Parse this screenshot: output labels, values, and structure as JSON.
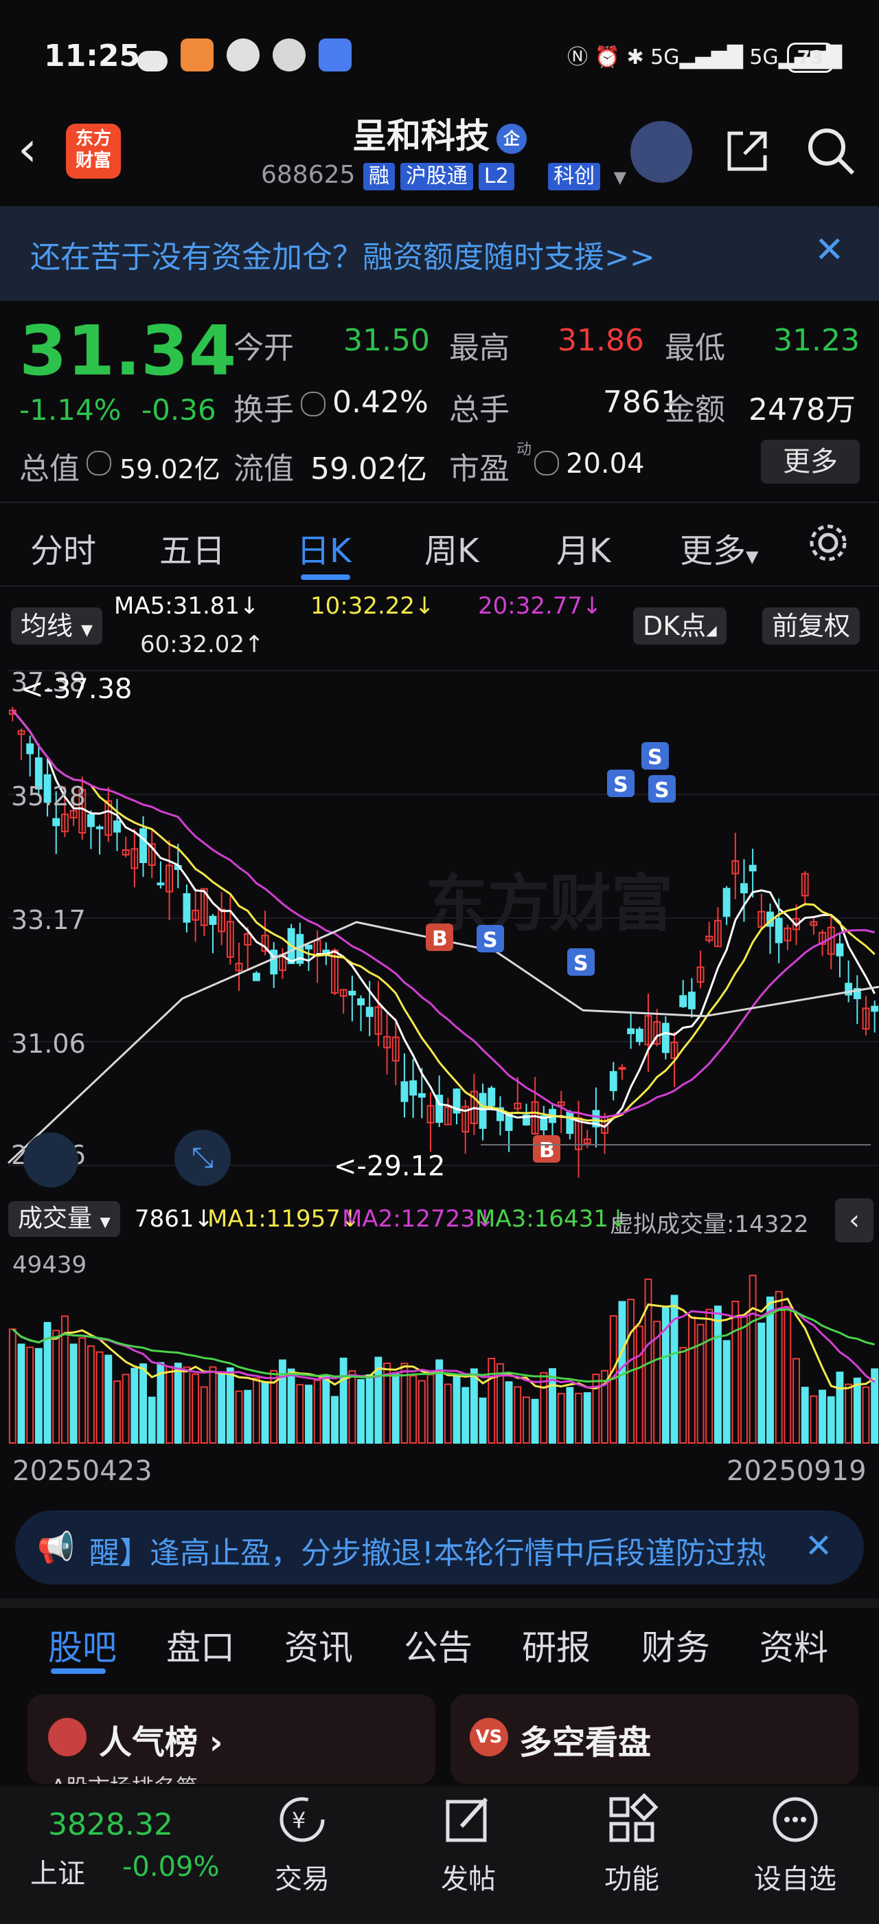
{
  "status": {
    "time": "11:25",
    "battery": "73",
    "network": "5G"
  },
  "header": {
    "logo": "东方\n财富",
    "title": "呈和科技",
    "badge": "企",
    "code": "688625",
    "tags": [
      "融",
      "沪股通",
      "L2",
      "科创"
    ]
  },
  "banner": {
    "text": "还在苦于没有资金加仓？融资额度随时支援>>",
    "close": "✕"
  },
  "quote": {
    "price": "31.34",
    "pct": "-1.14%",
    "change": "-0.36",
    "open_label": "今开",
    "open": "31.50",
    "high_label": "最高",
    "high": "31.86",
    "low_label": "最低",
    "low": "31.23",
    "turnover_label": "换手",
    "turnover": "0.42%",
    "volume_label": "总手",
    "volume": "7861",
    "amount_label": "金额",
    "amount": "2478万",
    "mktcap_label": "总值",
    "mktcap": "59.02亿",
    "float_label": "流值",
    "float": "59.02亿",
    "pe_label": "市盈",
    "pe_sup": "动",
    "pe": "20.04",
    "more": "更多"
  },
  "period_tabs": [
    "分时",
    "五日",
    "日K",
    "周K",
    "月K",
    "更多"
  ],
  "chart_toolbar": {
    "indicator": "均线",
    "ma5": "MA5:31.81↓",
    "ma10": "10:32.22↓",
    "ma20": "20:32.77↓",
    "ma60": "60:32.02↑",
    "dk": "DK点",
    "adjust": "前复权"
  },
  "price_axis": [
    "37.38",
    "35.28",
    "33.17",
    "31.06",
    "28.96"
  ],
  "annotations": {
    "high": "<-37.38",
    "low": "<-29.12",
    "buy": "B",
    "sell": "S"
  },
  "volume_bar": {
    "label": "成交量",
    "vol": "7861↓",
    "ma1": "MA1:11957↓",
    "ma2": "MA2:12723↓",
    "ma3": "MA3:16431↓",
    "virtual": "虚拟成交量:14322",
    "vmax": "49439"
  },
  "dates": {
    "start": "20250423",
    "end": "20250919"
  },
  "colors": {
    "up": "#f03a3a",
    "down": "#5be7ef",
    "ma5": "#ffffff",
    "ma10": "#f5e84a",
    "ma20": "#d23fd2",
    "ma60": "#d8d8d8",
    "accent": "#3d8bf5"
  },
  "chart_data": {
    "type": "candlestick",
    "y_range": [
      28.96,
      37.38
    ],
    "x_range": [
      "20250423",
      "20250919"
    ],
    "max_high": 37.38,
    "min_low": 29.12,
    "last_close": 31.34,
    "series": [
      {
        "name": "MA5",
        "last": 31.81
      },
      {
        "name": "MA10",
        "last": 32.22
      },
      {
        "name": "MA20",
        "last": 32.77
      },
      {
        "name": "MA60",
        "last": 32.02
      }
    ],
    "volume": {
      "max": 49439,
      "last": 7861,
      "MA1": 11957,
      "MA2": 12723,
      "MA3": 16431
    }
  },
  "alert": {
    "text": "醒】逢高止盈，分步撤退!本轮行情中后段谨防过热",
    "close": "✕"
  },
  "bottom_tabs": [
    "股吧",
    "盘口",
    "资讯",
    "公告",
    "研报",
    "财务",
    "资料"
  ],
  "cards": [
    {
      "title": "人气榜",
      "sub": "A股市场排名第"
    },
    {
      "title": "多空看盘"
    }
  ],
  "index": {
    "value": "3828.32",
    "name": "上证",
    "pct": "-0.09%"
  },
  "nav": [
    "交易",
    "发帖",
    "功能",
    "设自选"
  ]
}
